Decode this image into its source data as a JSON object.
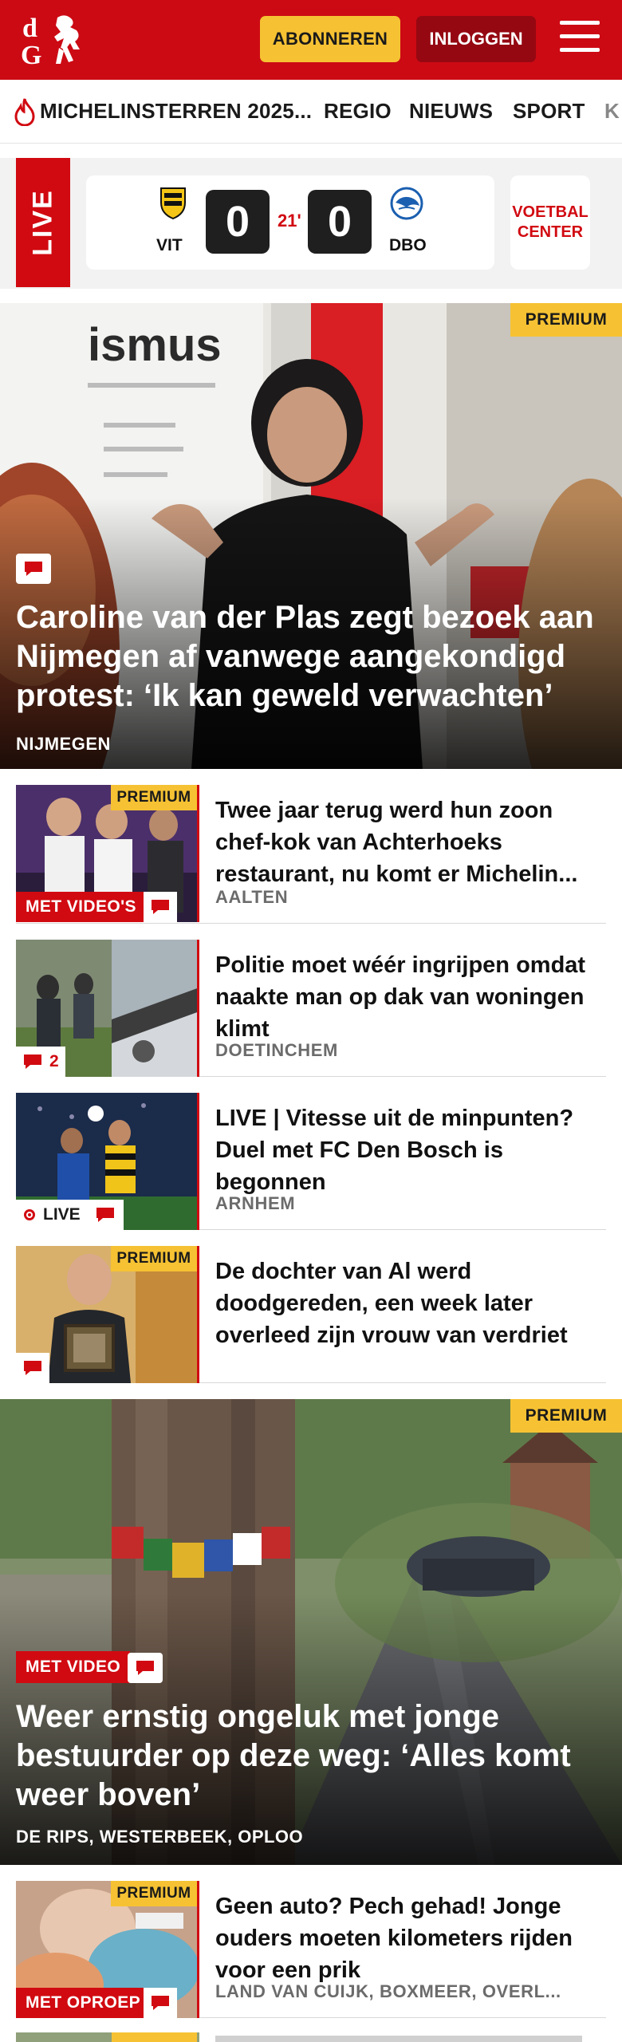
{
  "header": {
    "subscribe_label": "ABONNEREN",
    "login_label": "INLOGGEN",
    "menu_icon": "hamburger-icon",
    "brand_color": "#cc0a14",
    "accent_color": "#f6c233"
  },
  "nav": {
    "items": [
      {
        "label": "MICHELINSTERREN 2025...",
        "icon": "flame-icon"
      },
      {
        "label": "REGIO"
      },
      {
        "label": "NIEUWS"
      },
      {
        "label": "SPORT"
      },
      {
        "label": "K"
      }
    ]
  },
  "live_match": {
    "tag": "LIVE",
    "home": {
      "name": "VIT",
      "score": "0"
    },
    "away": {
      "name": "DBO",
      "score": "0"
    },
    "minute": "21'",
    "voetbal_center": "VOETBAL CENTER"
  },
  "hero": {
    "badge": "PREMIUM",
    "title": "Caroline van der Plas zegt bezoek aan Nijmegen af vanwege aangekondigd protest: ‘Ik kan geweld verwachten’",
    "place": "NIJMEGEN",
    "photo_text": "ismus"
  },
  "articles": [
    {
      "title": "Twee jaar terug werd hun zoon chef-kok van Achterhoeks restaurant, nu komt er Michelin...",
      "place": "AALTEN",
      "premium": "PREMIUM",
      "badge": "MET VIDEO'S"
    },
    {
      "title": "Politie moet wéér ingrijpen omdat naakte man op dak van woningen klimt",
      "place": "DOETINCHEM",
      "comments": "2"
    },
    {
      "title": "LIVE | Vitesse uit de minpunten? Duel met FC Den Bosch is begonnen",
      "place": "ARNHEM",
      "live": "LIVE"
    },
    {
      "title": "De dochter van Al werd doodgereden, een week later overleed zijn vrouw van verdriet",
      "premium": "PREMIUM"
    }
  ],
  "hero2": {
    "badge": "PREMIUM",
    "video_badge": "MET VIDEO",
    "title": "Weer ernstig ongeluk met jonge bestuurder op deze weg: ‘Alles komt weer boven’",
    "place": "DE RIPS, WESTERBEEK, OPLOO"
  },
  "articles2": [
    {
      "title": "Geen auto? Pech gehad! Jonge ouders moeten kilometers rijden voor een prik",
      "place": "LAND VAN CUIJK, BOXMEER, OVERL...",
      "premium": "PREMIUM",
      "badge": "MET OPROEP"
    }
  ]
}
